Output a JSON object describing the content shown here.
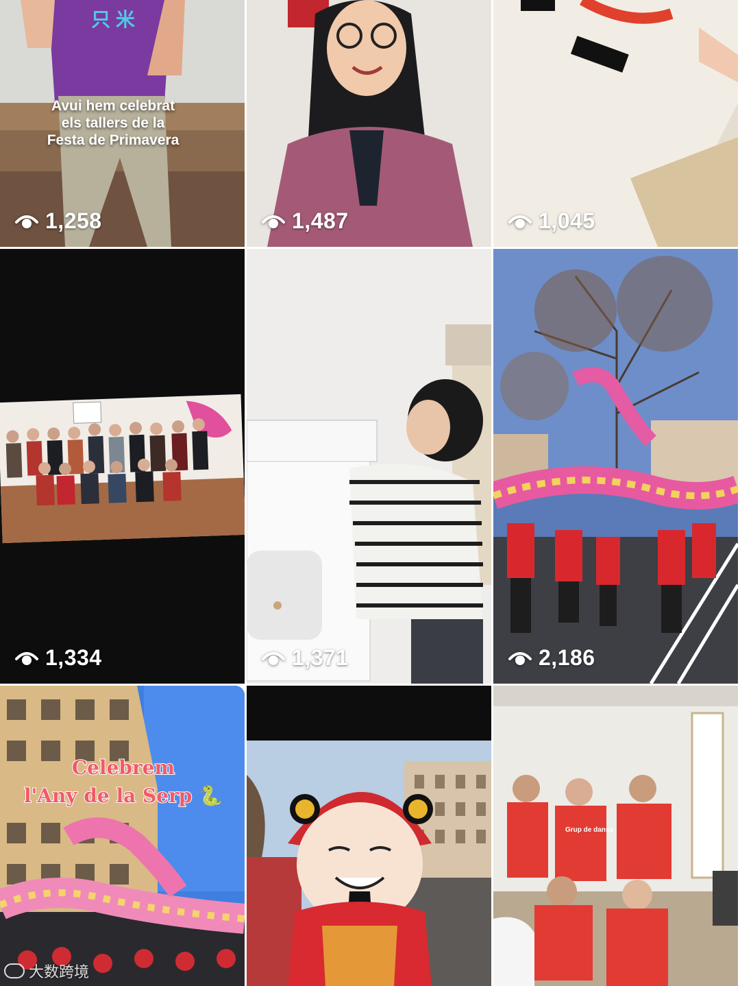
{
  "grid": {
    "tiles": [
      {
        "views": "1,258",
        "caption_lines": [
          "Avui hem celebrat",
          "els tallers de la",
          "Festa de Primavera"
        ],
        "shirt_chars": "只 米"
      },
      {
        "views": "1,487"
      },
      {
        "views": "1,045"
      },
      {
        "views": "1,334"
      },
      {
        "views": "1,371"
      },
      {
        "views": "2,186"
      },
      {
        "title_lines": [
          "Celebrem",
          "l'Any de la Serp 🐍"
        ]
      },
      {},
      {
        "shirt_text": "Grup de dansa"
      }
    ]
  },
  "watermark": {
    "text": "大数跨境"
  },
  "icons": {
    "views": "eye-icon"
  }
}
